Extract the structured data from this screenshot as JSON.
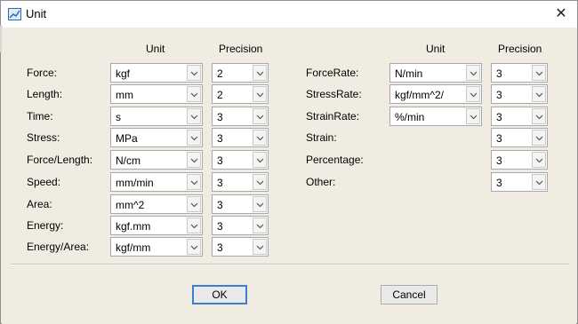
{
  "window": {
    "title": "Unit",
    "close_glyph": "✕"
  },
  "headers": {
    "left_unit": "Unit",
    "left_precision": "Precision",
    "right_unit": "Unit",
    "right_precision": "Precision"
  },
  "left_rows": [
    {
      "label": "Force:",
      "unit": "kgf",
      "precision": "2"
    },
    {
      "label": "Length:",
      "unit": "mm",
      "precision": "2"
    },
    {
      "label": "Time:",
      "unit": "s",
      "precision": "3"
    },
    {
      "label": "Stress:",
      "unit": "MPa",
      "precision": "3"
    },
    {
      "label": "Force/Length:",
      "unit": "N/cm",
      "precision": "3"
    },
    {
      "label": "Speed:",
      "unit": "mm/min",
      "precision": "3"
    },
    {
      "label": "Area:",
      "unit": "mm^2",
      "precision": "3"
    },
    {
      "label": "Energy:",
      "unit": "kgf.mm",
      "precision": "3"
    },
    {
      "label": "Energy/Area:",
      "unit": "kgf/mm",
      "precision": "3"
    }
  ],
  "right_rows": [
    {
      "label": "ForceRate:",
      "unit": "N/min",
      "precision": "3"
    },
    {
      "label": "StressRate:",
      "unit": "kgf/mm^2/",
      "precision": "3"
    },
    {
      "label": "StrainRate:",
      "unit": "%/min",
      "precision": "3"
    },
    {
      "label": "Strain:",
      "precision": "3"
    },
    {
      "label": "Percentage:",
      "precision": "3"
    },
    {
      "label": "Other:",
      "precision": "3"
    }
  ],
  "buttons": {
    "ok": "OK",
    "cancel": "Cancel"
  },
  "icons": {
    "app": "window-app-icon",
    "close": "close-icon",
    "dropdown": "chevron-down-icon"
  },
  "colors": {
    "dialog_background": "#f0ece1",
    "default_button_border": "#3c7fd1"
  }
}
